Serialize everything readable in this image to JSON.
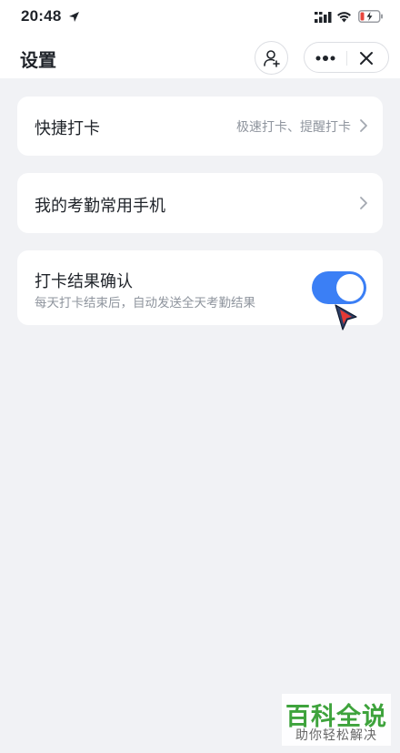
{
  "status_bar": {
    "time": "20:48",
    "icons": [
      "location-arrow-icon",
      "signal-icon",
      "wifi-icon",
      "battery-charging-icon"
    ],
    "battery_color": "#e8453c"
  },
  "nav": {
    "title": "设置",
    "contact_icon": "add-contact-icon",
    "more_icon": "more-dots-icon",
    "close_icon": "close-icon"
  },
  "settings": [
    {
      "label": "快捷打卡",
      "value": "极速打卡、提醒打卡",
      "icon": "chevron-right-icon"
    },
    {
      "label": "我的考勤常用手机",
      "icon": "chevron-right-icon"
    },
    {
      "label": "打卡结果确认",
      "description": "每天打卡结束后，自动发送全天考勤结果",
      "toggle_on": true
    }
  ],
  "colors": {
    "accent": "#3b7ff5",
    "page_bg": "#f1f2f5",
    "secondary_text": "#8f959e"
  },
  "watermark": {
    "title": "百科全说",
    "subtitle": "助你轻松解决"
  }
}
